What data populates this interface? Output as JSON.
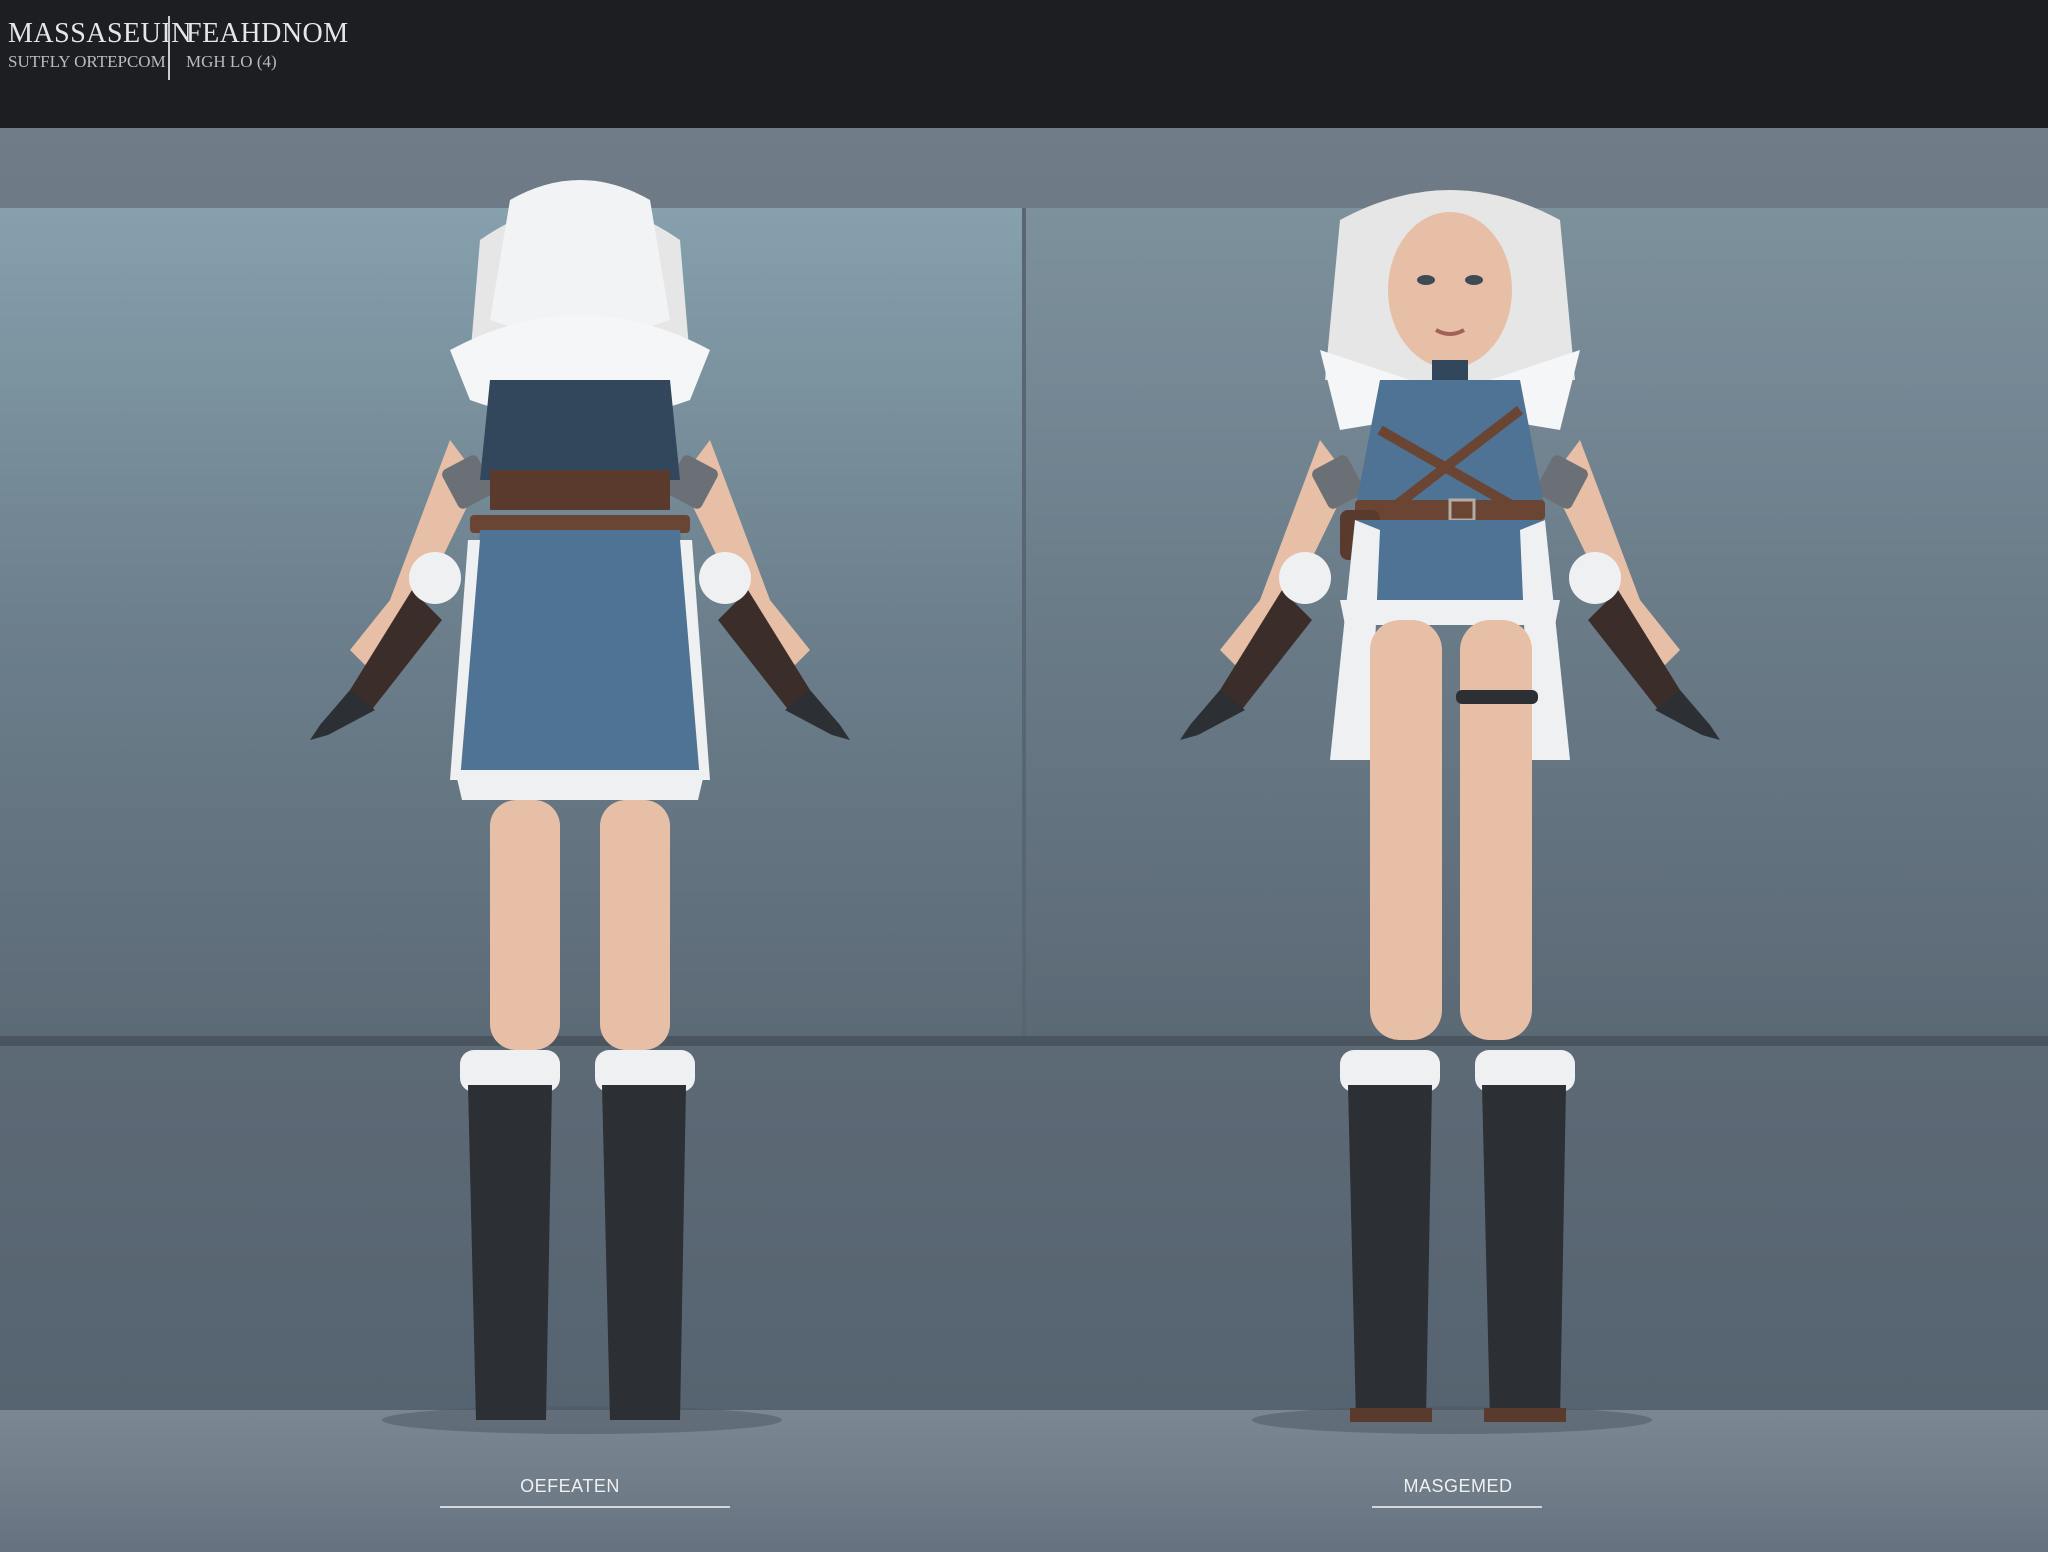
{
  "header": {
    "left_title": "MASSASEUIN",
    "left_subtitle": "SUTFLY ORTEPCOM",
    "right_title": "FEAHDNOM",
    "right_subtitle": "MGH LO (4)"
  },
  "views": [
    {
      "caption": "OEFEATEN"
    },
    {
      "caption": "MASGEMED"
    }
  ],
  "colors": {
    "header_bg": "#1d1e21",
    "dress": "#4f7394",
    "fur": "#eef0f2",
    "leather": "#5a3a2c",
    "boot": "#2c2f34",
    "skin": "#e7bfa6",
    "hair": "#e6e6e6"
  }
}
